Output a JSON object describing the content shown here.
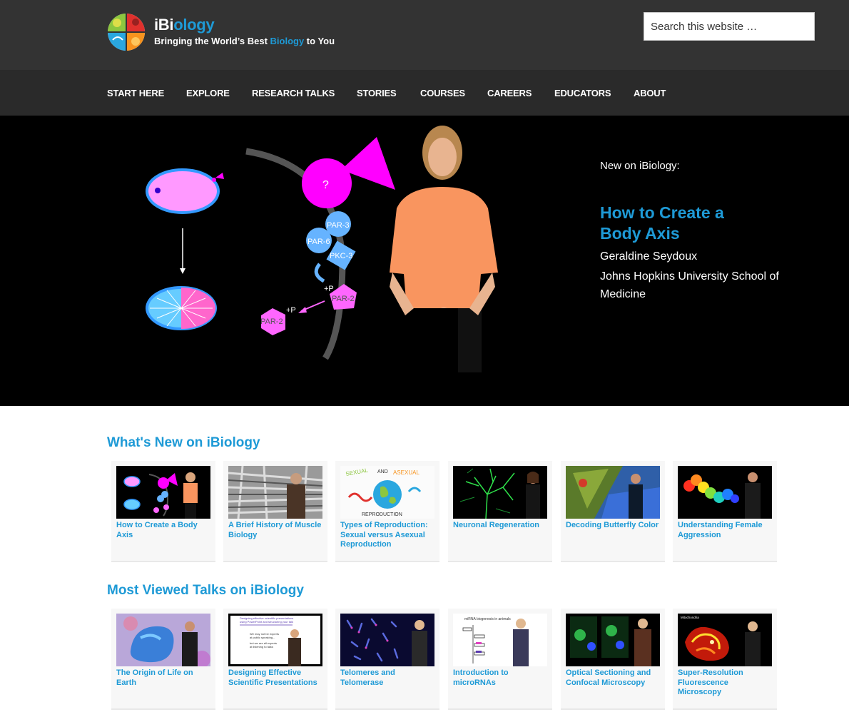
{
  "header": {
    "logo_name_a": "iBi",
    "logo_name_b": "o",
    "logo_name_c": "logy",
    "tagline_a": "Bringing the World’s Best ",
    "tagline_b": "Biology",
    "tagline_c": " to You",
    "search_placeholder": "Search this website …"
  },
  "nav": {
    "items": [
      "START HERE",
      "EXPLORE",
      "RESEARCH TALKS",
      "STORIES",
      "COURSES",
      "CAREERS",
      "EDUCATORS",
      "ABOUT"
    ]
  },
  "hero": {
    "kicker": "New on iBiology:",
    "title": "How to Create a Body Axis",
    "speaker": "Geraldine Seydoux",
    "institution": "Johns Hopkins University School of Medicine",
    "diagram_labels": [
      "?",
      "PAR-3",
      "PAR-6",
      "PKC-3",
      "+P",
      "PAR-2",
      "+P",
      "PAR-2"
    ]
  },
  "whats_new": {
    "title": "What's New on iBiology",
    "cards": [
      {
        "title": "How to Create a Body Axis",
        "thumb": "body-axis"
      },
      {
        "title": "A Brief History of Muscle Biology",
        "thumb": "muscle"
      },
      {
        "title": "Types of Reproduction: Sexual versus Asexual Reproduction",
        "thumb": "reproduction"
      },
      {
        "title": "Neuronal Regeneration",
        "thumb": "neuron"
      },
      {
        "title": "Decoding Butterfly Color",
        "thumb": "butterfly"
      },
      {
        "title": "Understanding Female Aggression",
        "thumb": "aggression"
      }
    ],
    "thumb_text": {
      "sexual": "SEXUAL",
      "and": "AND",
      "asexual": "ASEXUAL",
      "reproduction": "REPRODUCTION"
    }
  },
  "most_viewed": {
    "title": "Most Viewed Talks on iBiology",
    "cards": [
      {
        "title": "The Origin of Life on Earth",
        "thumb": "origin"
      },
      {
        "title": "Designing Effective Scientific Presentations",
        "thumb": "presentations"
      },
      {
        "title": "Telomeres and Telomerase",
        "thumb": "telomeres"
      },
      {
        "title": "Introduction to microRNAs",
        "thumb": "microrna"
      },
      {
        "title": "Optical Sectioning and Confocal Microscopy",
        "thumb": "confocal"
      },
      {
        "title": "Super-Resolution Fluorescence Microscopy",
        "thumb": "superres"
      }
    ],
    "thumb_text": {
      "presentations_1": "Designing effective scientific presentations",
      "presentations_2": "using PowerPoint and structuring your talk",
      "presentations_3": "We may not be experts",
      "presentations_4": "at public speaking...",
      "presentations_5": "but we are all experts",
      "presentations_6": "at listening to talks",
      "microrna": "miRNA biogenesis in animals",
      "superres": "Mitochondria"
    }
  },
  "colors": {
    "accent": "#1e9ad6",
    "header_bg": "#333333",
    "nav_bg": "#2a2a2a",
    "hero_bg": "#000000",
    "magenta": "#ff00ff"
  }
}
